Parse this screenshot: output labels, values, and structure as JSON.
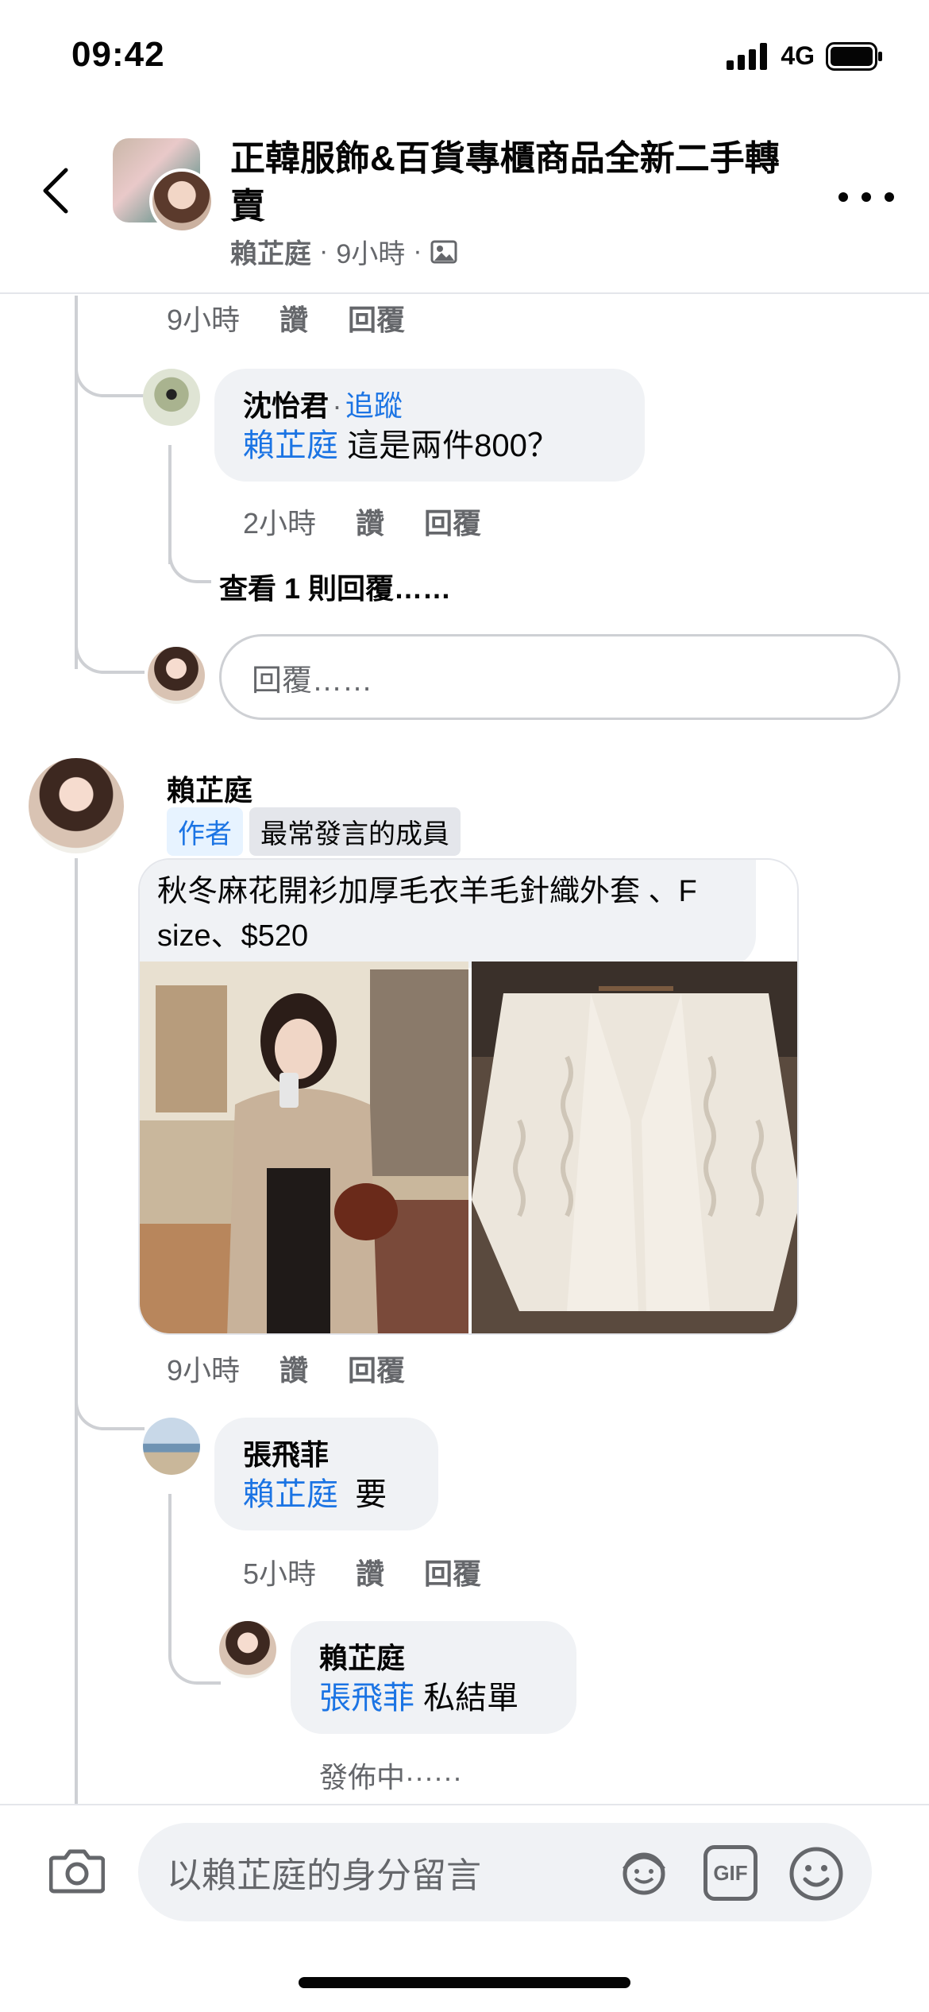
{
  "status": {
    "time": "09:42",
    "network": "4G"
  },
  "header": {
    "title": "正韓服飾&百貨專櫃商品全新二手轉賣",
    "author": "賴芷庭",
    "time": "9小時",
    "sep": "·"
  },
  "thread_top": {
    "actions": {
      "time": "9小時",
      "like": "讚",
      "reply": "回覆"
    }
  },
  "reply1": {
    "name": "沈怡君",
    "follow": "追蹤",
    "sep": "·",
    "mention": "賴芷庭",
    "text": "這是兩件800？",
    "actions": {
      "time": "2小時",
      "like": "讚",
      "reply": "回覆"
    },
    "view_replies": "查看 1 則回覆……"
  },
  "reply_input": {
    "placeholder": "回覆……"
  },
  "comment": {
    "name": "賴芷庭",
    "badge_author": "作者",
    "badge_member": "最常發言的成員",
    "text": "秋冬麻花開衫加厚毛衣羊毛針織外套 、F size、$520",
    "actions": {
      "time": "9小時",
      "like": "讚",
      "reply": "回覆"
    }
  },
  "reply2": {
    "name": "張飛菲",
    "mention": "賴芷庭",
    "text": "要",
    "actions": {
      "time": "5小時",
      "like": "讚",
      "reply": "回覆"
    }
  },
  "reply3": {
    "name": "賴芷庭",
    "mention": "張飛菲",
    "text": "私結單",
    "status": "發佈中······"
  },
  "composer": {
    "placeholder": "以賴芷庭的身分留言",
    "gif": "GIF"
  },
  "colors": {
    "link": "#1b74e4",
    "bubble": "#f0f2f5",
    "muted": "#65676b"
  },
  "icons": [
    "back-arrow-icon",
    "more-icon",
    "photo-icon",
    "camera-icon",
    "avatar-sticker-icon",
    "gif-icon",
    "emoji-icon",
    "signal-icon",
    "battery-icon"
  ]
}
